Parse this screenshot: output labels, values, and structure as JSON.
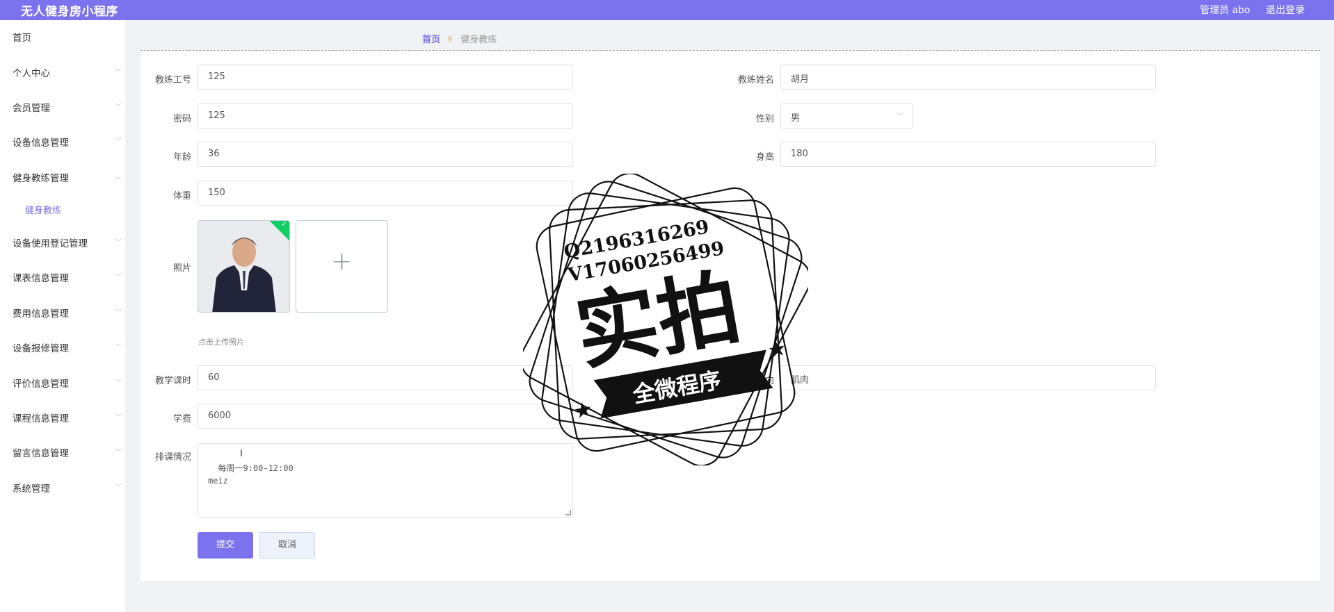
{
  "app": {
    "title": "无人健身房小程序"
  },
  "header": {
    "admin_label": "管理员 abo",
    "logout_label": "退出登录"
  },
  "sidebar": {
    "items": [
      {
        "label": "首页"
      },
      {
        "label": "个人中心"
      },
      {
        "label": "会员管理"
      },
      {
        "label": "设备信息管理"
      },
      {
        "label": "健身教练管理"
      },
      {
        "label": "健身教练"
      },
      {
        "label": "设备使用登记管理"
      },
      {
        "label": "课表信息管理"
      },
      {
        "label": "费用信息管理"
      },
      {
        "label": "设备报修管理"
      },
      {
        "label": "评价信息管理"
      },
      {
        "label": "课程信息管理"
      },
      {
        "label": "留言信息管理"
      },
      {
        "label": "系统管理"
      }
    ]
  },
  "breadcrumb": {
    "home": "首页",
    "current": "健身教练"
  },
  "form": {
    "coach_id": {
      "label": "教练工号",
      "value": "125"
    },
    "coach_name": {
      "label": "教练姓名",
      "value": "胡月"
    },
    "password": {
      "label": "密码",
      "value": "125"
    },
    "gender": {
      "label": "性别",
      "value": "男"
    },
    "age": {
      "label": "年龄",
      "value": "36"
    },
    "height": {
      "label": "身高",
      "value": "180"
    },
    "weight": {
      "label": "体重",
      "value": "150"
    },
    "photo": {
      "label": "照片",
      "hint": "点击上传照片"
    },
    "hours": {
      "label": "教学课时",
      "value": "60"
    },
    "direction": {
      "label": "方向",
      "value": "肌肉"
    },
    "fee": {
      "label": "学费",
      "value": "6000"
    },
    "schedule": {
      "label": "排课情况",
      "value": "每周一9:00-12:00\nmeiz"
    },
    "submit_label": "提交",
    "cancel_label": "取消"
  },
  "watermark": {
    "line1": "Q2196316269",
    "line2": "V17060256499",
    "big": "实拍",
    "banner": "全微程序"
  },
  "colors": {
    "accent": "#7b72ee",
    "success": "#13ce66"
  }
}
